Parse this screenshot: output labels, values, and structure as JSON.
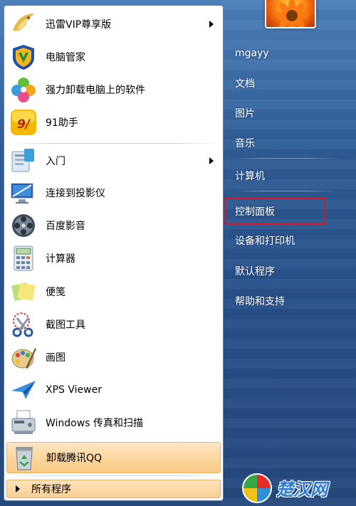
{
  "programs": [
    {
      "label": "迅雷VIP尊享版",
      "icon": "xunlei-bird-icon",
      "has_submenu": true
    },
    {
      "label": "电脑管家",
      "icon": "tencent-pc-manager-shield-icon",
      "has_submenu": false
    },
    {
      "label": "强力卸载电脑上的软件",
      "icon": "uninstaller-clover-icon",
      "has_submenu": false
    },
    {
      "label": "91助手",
      "icon": "91-assistant-icon",
      "has_submenu": false
    },
    {
      "label": "入门",
      "icon": "getting-started-icon",
      "has_submenu": true
    },
    {
      "label": "连接到投影仪",
      "icon": "projector-display-icon",
      "has_submenu": false
    },
    {
      "label": "百度影音",
      "icon": "baidu-player-reel-icon",
      "has_submenu": false
    },
    {
      "label": "计算器",
      "icon": "calculator-icon",
      "has_submenu": false
    },
    {
      "label": "便笺",
      "icon": "sticky-notes-icon",
      "has_submenu": false
    },
    {
      "label": "截图工具",
      "icon": "snipping-tool-scissors-icon",
      "has_submenu": false
    },
    {
      "label": "画图",
      "icon": "paint-palette-icon",
      "has_submenu": false
    },
    {
      "label": "XPS Viewer",
      "icon": "xps-viewer-plane-icon",
      "has_submenu": false
    },
    {
      "label": "Windows 传真和扫描",
      "icon": "fax-scanner-icon",
      "has_submenu": false
    },
    {
      "label": "卸载腾讯QQ",
      "icon": "recycle-bin-icon",
      "has_submenu": false
    }
  ],
  "all_programs_label": "所有程序",
  "right": {
    "user_name": "mgayy",
    "documents": "文档",
    "pictures": "图片",
    "music": "音乐",
    "computer": "计算机",
    "control_panel": "控制面板",
    "devices_printers": "设备和打印机",
    "default_programs": "默认程序",
    "help_support": "帮助和支持"
  },
  "watermark_text": "楚汉网",
  "colors": {
    "menu_blue": "#2f5c96",
    "highlight_orange": "#fbd69f",
    "annotation_red": "#e1121b"
  }
}
